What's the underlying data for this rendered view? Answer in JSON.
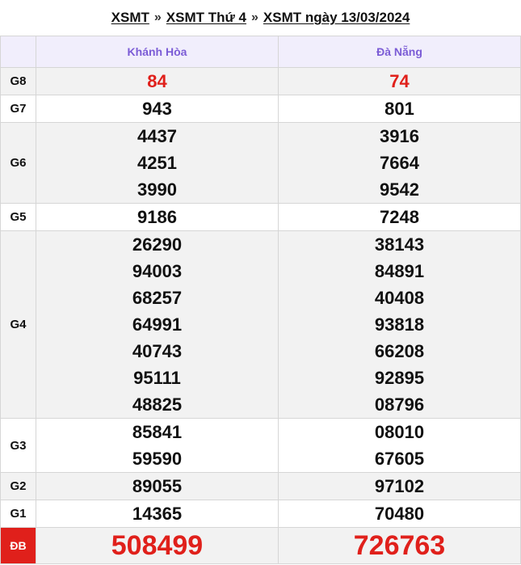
{
  "breadcrumb": {
    "items": [
      "XSMT",
      "XSMT Thứ 4",
      "XSMT ngày 13/03/2024"
    ],
    "separator": "»"
  },
  "provinces": [
    "Khánh Hòa",
    "Đà Nẵng"
  ],
  "prizes": [
    {
      "label": "G8",
      "khanh_hoa": [
        "84"
      ],
      "da_nang": [
        "74"
      ]
    },
    {
      "label": "G7",
      "khanh_hoa": [
        "943"
      ],
      "da_nang": [
        "801"
      ]
    },
    {
      "label": "G6",
      "khanh_hoa": [
        "4437",
        "4251",
        "3990"
      ],
      "da_nang": [
        "3916",
        "7664",
        "9542"
      ]
    },
    {
      "label": "G5",
      "khanh_hoa": [
        "9186"
      ],
      "da_nang": [
        "7248"
      ]
    },
    {
      "label": "G4",
      "khanh_hoa": [
        "26290",
        "94003",
        "68257",
        "64991",
        "40743",
        "95111",
        "48825"
      ],
      "da_nang": [
        "38143",
        "84891",
        "40408",
        "93818",
        "66208",
        "92895",
        "08796"
      ]
    },
    {
      "label": "G3",
      "khanh_hoa": [
        "85841",
        "59590"
      ],
      "da_nang": [
        "08010",
        "67605"
      ]
    },
    {
      "label": "G2",
      "khanh_hoa": [
        "89055"
      ],
      "da_nang": [
        "97102"
      ]
    },
    {
      "label": "G1",
      "khanh_hoa": [
        "14365"
      ],
      "da_nang": [
        "70480"
      ]
    },
    {
      "label": "ĐB",
      "khanh_hoa": [
        "508499"
      ],
      "da_nang": [
        "726763"
      ]
    }
  ],
  "colors": {
    "accent_red": "#e0201b",
    "header_purple": "#7b5cd6",
    "header_bg": "#f1eefc",
    "alt_row_bg": "#f2f2f2"
  }
}
